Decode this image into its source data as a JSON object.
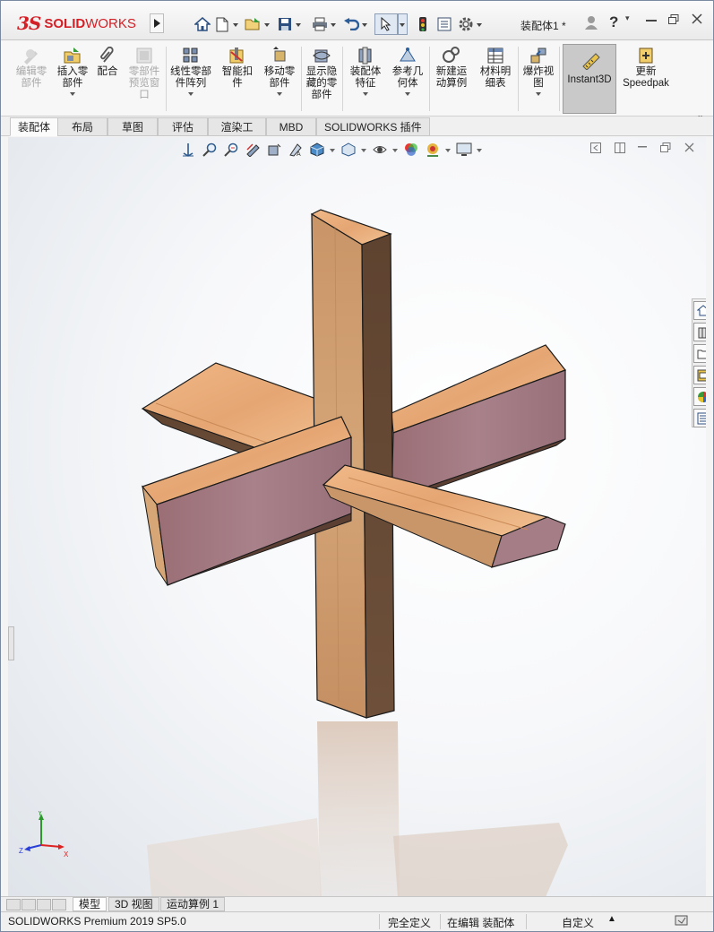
{
  "brand": {
    "ds": "3S",
    "name_bold": "SOLID",
    "name_rest": "WORKS"
  },
  "titlebar": {
    "document_title": "装配体1 *",
    "quick_access": [
      "home-icon",
      "new-document-icon",
      "open-icon",
      "save-icon",
      "print-icon",
      "undo-icon",
      "select-icon",
      "rebuild-icon",
      "file-properties-icon",
      "options-icon"
    ]
  },
  "commands": {
    "edit_component": "编辑零\n部件",
    "insert_components": "插入零\n部件",
    "mate": "配合",
    "component_preview": "零部件\n预览窗\n口",
    "linear_pattern": "线性零部\n件阵列",
    "smart_fasteners": "智能扣\n件",
    "move_component": "移动零\n部件",
    "show_hidden": "显示隐\n藏的零\n部件",
    "assembly_features": "装配体\n特征",
    "reference_geometry": "参考几\n何体",
    "new_motion_study": "新建运\n动算例",
    "bill_of_materials": "材料明\n细表",
    "exploded_view": "爆炸视\n图",
    "instant3d": "Instant3D",
    "update_speedpak": "更新\nSpeedpak"
  },
  "tabs": [
    "装配体",
    "布局",
    "草图",
    "评估",
    "渲染工具",
    "MBD",
    "SOLIDWORKS 插件"
  ],
  "active_tab": "装配体",
  "bottom_tabs": [
    "模型",
    "3D 视图",
    "运动算例 1"
  ],
  "active_bottom_tab": "模型",
  "status": {
    "product": "SOLIDWORKS Premium 2019 SP5.0",
    "definition": "完全定义",
    "editing": "在编辑 装配体",
    "units": "自定义"
  },
  "triad": {
    "x": "X",
    "y": "Y",
    "z": "Z"
  },
  "colors": {
    "brand_red": "#d31f26",
    "wood_light": "#e9b07f",
    "wood_mid": "#d99c68",
    "wood_dark": "#6b4a34",
    "panel_pink": "#a3757d"
  }
}
